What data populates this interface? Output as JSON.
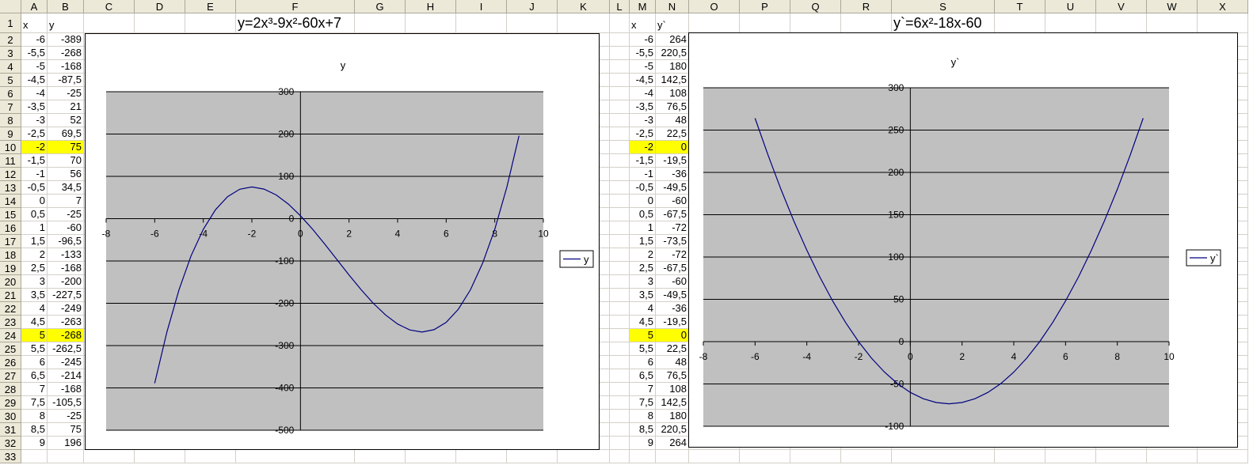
{
  "columns": [
    "A",
    "B",
    "C",
    "D",
    "E",
    "F",
    "G",
    "H",
    "I",
    "J",
    "K",
    "L",
    "M",
    "N",
    "O",
    "P",
    "Q",
    "R",
    "S",
    "T",
    "U",
    "V",
    "W",
    "X"
  ],
  "row_count": 33,
  "highlight_color": "#ffff00",
  "left_table": {
    "headers": [
      "x",
      "y"
    ],
    "formula": "y=2x³-9x²-60x+7",
    "rows": [
      [
        "-6",
        "-389"
      ],
      [
        "-5,5",
        "-268"
      ],
      [
        "-5",
        "-168"
      ],
      [
        "-4,5",
        "-87,5"
      ],
      [
        "-4",
        "-25"
      ],
      [
        "-3,5",
        "21"
      ],
      [
        "-3",
        "52"
      ],
      [
        "-2,5",
        "69,5"
      ],
      [
        "-2",
        "75"
      ],
      [
        "-1,5",
        "70"
      ],
      [
        "-1",
        "56"
      ],
      [
        "-0,5",
        "34,5"
      ],
      [
        "0",
        "7"
      ],
      [
        "0,5",
        "-25"
      ],
      [
        "1",
        "-60"
      ],
      [
        "1,5",
        "-96,5"
      ],
      [
        "2",
        "-133"
      ],
      [
        "2,5",
        "-168"
      ],
      [
        "3",
        "-200"
      ],
      [
        "3,5",
        "-227,5"
      ],
      [
        "4",
        "-249"
      ],
      [
        "4,5",
        "-263"
      ],
      [
        "5",
        "-268"
      ],
      [
        "5,5",
        "-262,5"
      ],
      [
        "6",
        "-245"
      ],
      [
        "6,5",
        "-214"
      ],
      [
        "7",
        "-168"
      ],
      [
        "7,5",
        "-105,5"
      ],
      [
        "8",
        "-25"
      ],
      [
        "8,5",
        "75"
      ],
      [
        "9",
        "196"
      ]
    ],
    "highlighted_rows": [
      8,
      22
    ]
  },
  "right_table": {
    "headers": [
      "x",
      "y`"
    ],
    "formula": "y`=6x²-18x-60",
    "rows": [
      [
        "-6",
        "264"
      ],
      [
        "-5,5",
        "220,5"
      ],
      [
        "-5",
        "180"
      ],
      [
        "-4,5",
        "142,5"
      ],
      [
        "-4",
        "108"
      ],
      [
        "-3,5",
        "76,5"
      ],
      [
        "-3",
        "48"
      ],
      [
        "-2,5",
        "22,5"
      ],
      [
        "-2",
        "0"
      ],
      [
        "-1,5",
        "-19,5"
      ],
      [
        "-1",
        "-36"
      ],
      [
        "-0,5",
        "-49,5"
      ],
      [
        "0",
        "-60"
      ],
      [
        "0,5",
        "-67,5"
      ],
      [
        "1",
        "-72"
      ],
      [
        "1,5",
        "-73,5"
      ],
      [
        "2",
        "-72"
      ],
      [
        "2,5",
        "-67,5"
      ],
      [
        "3",
        "-60"
      ],
      [
        "3,5",
        "-49,5"
      ],
      [
        "4",
        "-36"
      ],
      [
        "4,5",
        "-19,5"
      ],
      [
        "5",
        "0"
      ],
      [
        "5,5",
        "22,5"
      ],
      [
        "6",
        "48"
      ],
      [
        "6,5",
        "76,5"
      ],
      [
        "7",
        "108"
      ],
      [
        "7,5",
        "142,5"
      ],
      [
        "8",
        "180"
      ],
      [
        "8,5",
        "220,5"
      ],
      [
        "9",
        "264"
      ]
    ],
    "highlighted_rows": [
      8,
      22
    ]
  },
  "chart_data": [
    {
      "type": "line",
      "title": "y",
      "legend": [
        "y"
      ],
      "legend_position": "right",
      "xlim": [
        -8,
        10
      ],
      "ylim": [
        -500,
        300
      ],
      "xticks": [
        -8,
        -6,
        -4,
        -2,
        0,
        2,
        4,
        6,
        8,
        10
      ],
      "yticks": [
        300,
        200,
        100,
        0,
        -100,
        -200,
        -300,
        -400,
        -500
      ],
      "grid": true,
      "plot_bg": "#c0c0c0",
      "line_color": "#000080",
      "x": [
        -6,
        -5.5,
        -5,
        -4.5,
        -4,
        -3.5,
        -3,
        -2.5,
        -2,
        -1.5,
        -1,
        -0.5,
        0,
        0.5,
        1,
        1.5,
        2,
        2.5,
        3,
        3.5,
        4,
        4.5,
        5,
        5.5,
        6,
        6.5,
        7,
        7.5,
        8,
        8.5,
        9
      ],
      "series": [
        {
          "name": "y",
          "values": [
            -389,
            -268,
            -168,
            -87.5,
            -25,
            21,
            52,
            69.5,
            75,
            70,
            56,
            34.5,
            7,
            -25,
            -60,
            -96.5,
            -133,
            -168,
            -200,
            -227.5,
            -249,
            -263,
            -268,
            -262.5,
            -245,
            -214,
            -168,
            -105.5,
            -25,
            75,
            196
          ]
        }
      ]
    },
    {
      "type": "line",
      "title": "y`",
      "legend": [
        "y`"
      ],
      "legend_position": "right",
      "xlim": [
        -8,
        10
      ],
      "ylim": [
        -100,
        300
      ],
      "xticks": [
        -8,
        -6,
        -4,
        -2,
        0,
        2,
        4,
        6,
        8,
        10
      ],
      "yticks": [
        300,
        250,
        200,
        150,
        100,
        50,
        0,
        -50,
        -100
      ],
      "grid": true,
      "plot_bg": "#c0c0c0",
      "line_color": "#000080",
      "x": [
        -6,
        -5.5,
        -5,
        -4.5,
        -4,
        -3.5,
        -3,
        -2.5,
        -2,
        -1.5,
        -1,
        -0.5,
        0,
        0.5,
        1,
        1.5,
        2,
        2.5,
        3,
        3.5,
        4,
        4.5,
        5,
        5.5,
        6,
        6.5,
        7,
        7.5,
        8,
        8.5,
        9
      ],
      "series": [
        {
          "name": "y`",
          "values": [
            264,
            220.5,
            180,
            142.5,
            108,
            76.5,
            48,
            22.5,
            0,
            -19.5,
            -36,
            -49.5,
            -60,
            -67.5,
            -72,
            -73.5,
            -72,
            -67.5,
            -60,
            -49.5,
            -36,
            -19.5,
            0,
            22.5,
            48,
            76.5,
            108,
            142.5,
            180,
            220.5,
            264
          ]
        }
      ]
    }
  ]
}
